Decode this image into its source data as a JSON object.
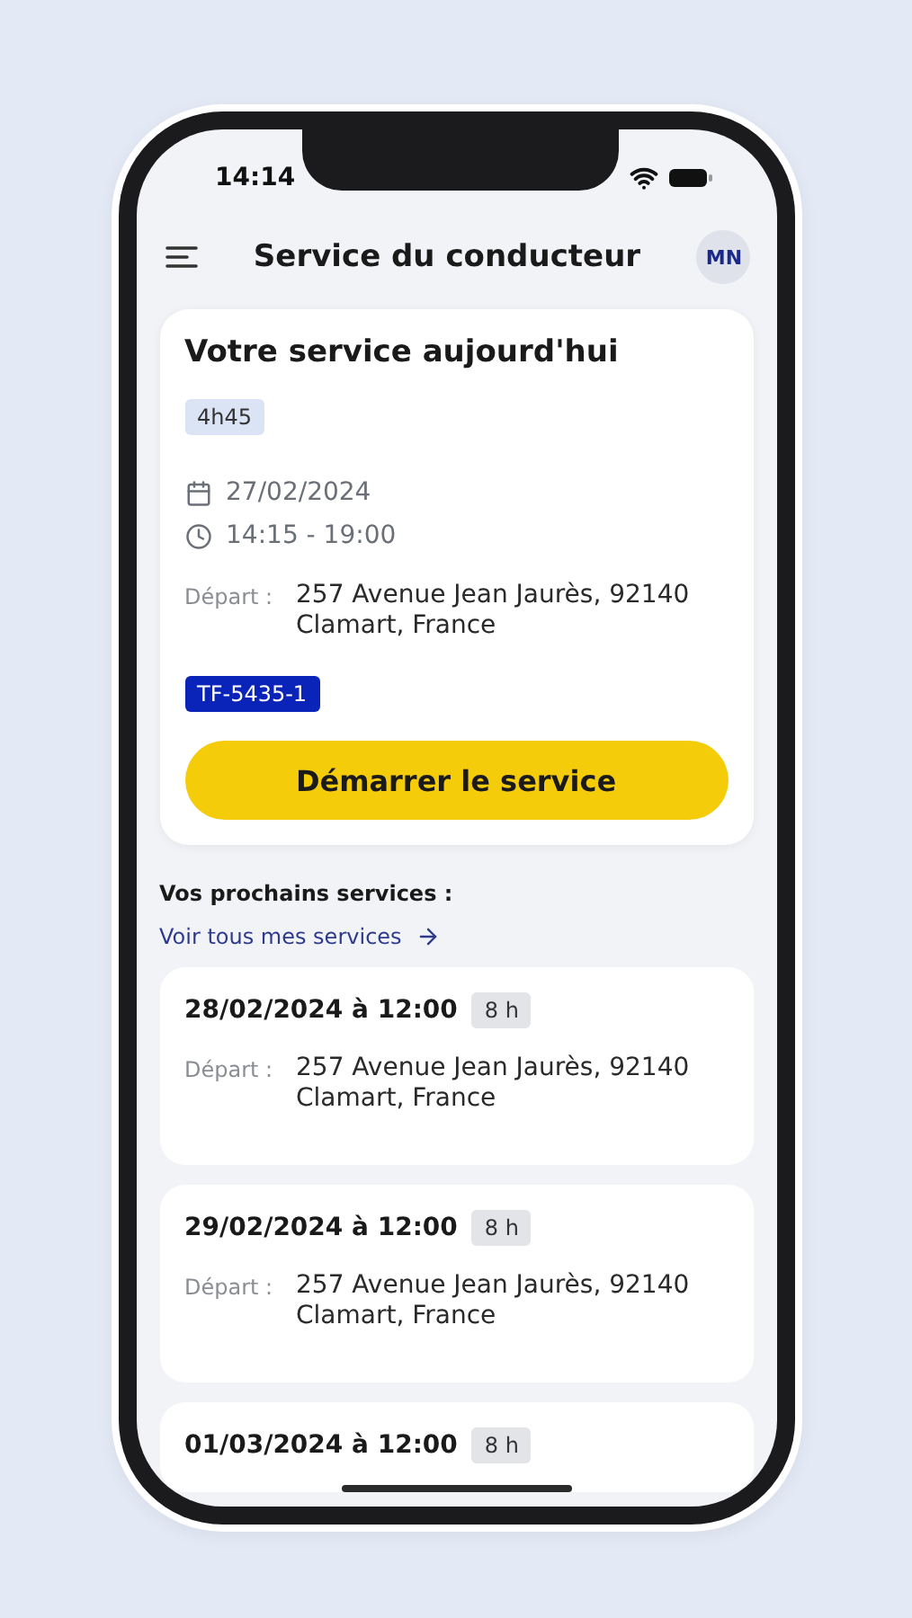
{
  "status_bar": {
    "time": "14:14"
  },
  "header": {
    "title": "Service du conducteur",
    "avatar_initials": "MN"
  },
  "today": {
    "title": "Votre service aujourd'hui",
    "duration": "4h45",
    "date": "27/02/2024",
    "time_range": "14:15 - 19:00",
    "departure_label": "Départ :",
    "address_lines": [
      "257 Avenue Jean Jaurès, 92140",
      "Clamart, France"
    ],
    "vehicle_code": "TF-5435-1",
    "button": "Démarrer le service"
  },
  "upcoming": {
    "heading": "Vos prochains services :",
    "link": "Voir tous mes services",
    "services": [
      {
        "datetime": "28/02/2024 à 12:00",
        "duration": "8 h",
        "departure_label": "Départ :",
        "address_lines": [
          "257 Avenue Jean Jaurès, 92140",
          "Clamart, France"
        ]
      },
      {
        "datetime": "29/02/2024 à 12:00",
        "duration": "8 h",
        "departure_label": "Départ :",
        "address_lines": [
          "257 Avenue Jean Jaurès, 92140",
          "Clamart, France"
        ]
      },
      {
        "datetime": "01/03/2024 à 12:00",
        "duration": "8 h"
      }
    ]
  }
}
